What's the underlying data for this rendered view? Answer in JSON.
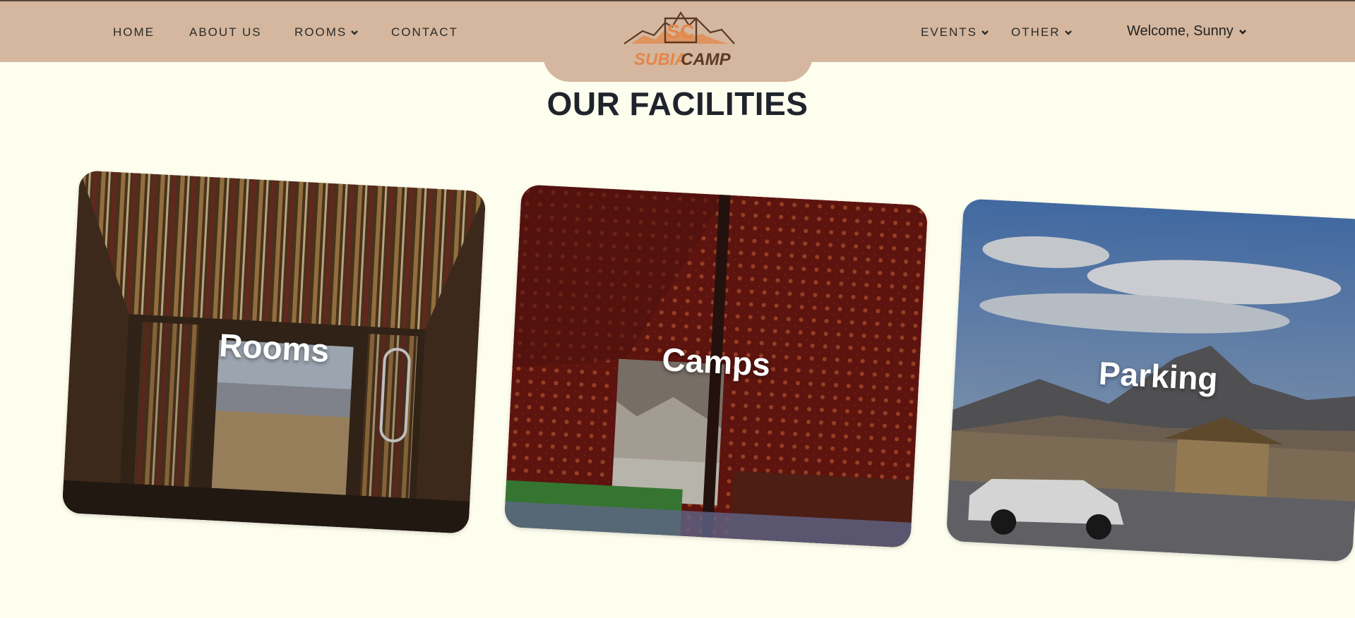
{
  "nav": {
    "left_items": [
      {
        "label": "HOME",
        "has_dropdown": false
      },
      {
        "label": "ABOUT US",
        "has_dropdown": false
      },
      {
        "label": "ROOMS",
        "has_dropdown": true
      },
      {
        "label": "CONTACT",
        "has_dropdown": false
      }
    ],
    "right_items": [
      {
        "label": "EVENTS",
        "has_dropdown": true
      },
      {
        "label": "OTHER",
        "has_dropdown": true
      }
    ],
    "welcome": "Welcome, Sunny",
    "logo_letters": "SC",
    "logo_name_part1": "SUBIA",
    "logo_name_part2": "CAMP"
  },
  "section": {
    "title": "OUR FACILITIES"
  },
  "cards": [
    {
      "label": "Rooms",
      "image": "tent-room-interior"
    },
    {
      "label": "Camps",
      "image": "red-tent-interior"
    },
    {
      "label": "Parking",
      "image": "parking-mountains-car"
    }
  ],
  "colors": {
    "nav_bg": "#d4b79e",
    "page_bg": "#fefeef",
    "logo_orange": "#e3874a",
    "logo_brown": "#5a3a26"
  }
}
